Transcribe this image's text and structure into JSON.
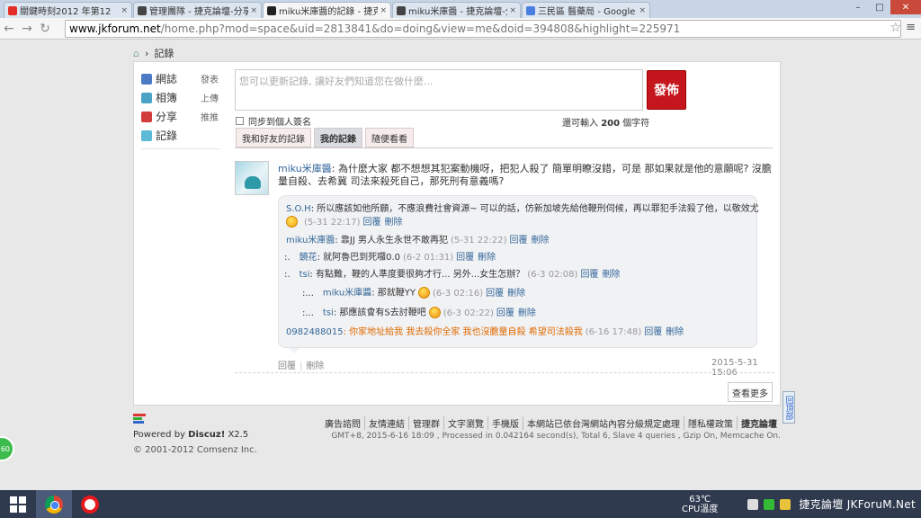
{
  "browser": {
    "tabs": [
      {
        "title": "關鍵時刻2012 年第12",
        "favicon_color": "#e52d27",
        "icon": "youtube-icon",
        "active": false
      },
      {
        "title": "管理團隊 - 捷克論壇-分享",
        "favicon_color": "#444444",
        "icon": "site-icon",
        "active": false
      },
      {
        "title": "miku米庫醬的記錄 - 捷克",
        "favicon_color": "#222222",
        "icon": "site-icon",
        "active": true
      },
      {
        "title": "miku米庫醬 - 捷克論壇-分享",
        "favicon_color": "#444444",
        "icon": "site-icon",
        "active": false
      },
      {
        "title": "三民區 醫藥局 - Google 搜",
        "favicon_color": "#4a7ee0",
        "icon": "google-icon",
        "active": false
      }
    ],
    "url_host": "www.jkforum.net",
    "url_path": "/home.php?mod=space&uid=2813841&do=doing&view=me&doid=394808&highlight=225971",
    "win_min": "–",
    "win_max": "□",
    "win_close": "✕",
    "tab_close": "×",
    "back": "←",
    "forward": "→",
    "reload": "↻",
    "star": "☆",
    "menu": "≡"
  },
  "breadcrumb": {
    "home_icon": "⌂",
    "sep": "›",
    "current": "記錄"
  },
  "sidebar": {
    "items": [
      {
        "label": "網誌",
        "action": "發表",
        "color": "#4a7bc4",
        "icon": "blog-icon"
      },
      {
        "label": "相簿",
        "action": "上傳",
        "color": "#4aa3c4",
        "icon": "album-icon"
      },
      {
        "label": "分享",
        "action": "推推",
        "color": "#d33b3b",
        "icon": "share-icon"
      },
      {
        "label": "記錄",
        "action": "",
        "color": "#5bbad5",
        "icon": "record-icon"
      }
    ]
  },
  "composer": {
    "placeholder": "您可以更新記錄, 讓好友們知道您在做什麼...",
    "post_button": "發佈",
    "sync_label": "同步到個人簽名",
    "remain_prefix": "還可輸入",
    "remain_count": "200",
    "remain_suffix": "個字符"
  },
  "subtabs": [
    {
      "label": "我和好友的記錄",
      "active": false
    },
    {
      "label": "我的記錄",
      "active": true
    },
    {
      "label": "隨便看看",
      "active": false
    }
  ],
  "feed": {
    "author": "miku米庫醬",
    "message": ": 為什麼大家 都不想想其犯案動機呀，把犯人殺了 簡單明瞭沒錯，可是 那如果就是他的意願呢? 沒膽量自殺、去希冀 司法來殺死自己，那死刑有意義嗎?",
    "reply_label": "回覆",
    "delete_label": "刪除",
    "date": "2015-5-31 15:06",
    "comments": [
      {
        "indent": "",
        "user": "S.O.H",
        "text": ": 所以應該如他所願，不應浪費社會資源~   可以的話，仿新加坡先給他鞭刑伺候，再以罪犯手法殺了他，以敬效尤",
        "time": "(5-31 22:17)",
        "emoji": true,
        "emoji_line2": true
      },
      {
        "indent": "",
        "user": "miku米庫醬",
        "text": ": 靠JJ  男人永生永世不敢再犯",
        "time": "(5-31 22:22)",
        "emoji": false
      },
      {
        "indent": ":.",
        "user": "鏡花",
        "text": ": 就阿魯巴到死囉0.0",
        "time": "(6-2 01:31)",
        "emoji": false
      },
      {
        "indent": ":.",
        "user": "tsi",
        "text": ": 有點難，鞭的人準度要很夠才行... 另外...女生怎辦？",
        "time": "(6-3 02:08)",
        "emoji": false
      },
      {
        "indent": ":...",
        "user": "miku米庫醬",
        "text": ": 那就鞭YY",
        "time": "(6-3 02:16)",
        "emoji": true
      },
      {
        "indent": ":...",
        "user": "tsi",
        "text": ": 那應該會有S去討鞭吧",
        "time": "(6-3 02:22)",
        "emoji": true
      },
      {
        "indent": "",
        "user": "0982488015",
        "text": ": 你家地址給我   我去殺你全家   我也沒膽量自殺   希望司法殺我",
        "time": "(6-16 17:48)",
        "emoji": false,
        "orange": true
      }
    ]
  },
  "more_button": "查看更多",
  "back_to_top": "回頂部",
  "footer": {
    "powered_prefix": "Powered by",
    "powered_name": "Discuz!",
    "powered_version": "X2.5",
    "copyright": "© 2001-2012 Comsenz Inc.",
    "links": [
      "廣告諮問",
      "友情連結",
      "管理群",
      "文字瀏覽",
      "手機版",
      "本網站已依台灣網站內容分級規定處理",
      "隱私權政策",
      "捷克論壇"
    ],
    "info": "GMT+8, 2015-6-16 18:09 , Processed in 0.042164 second(s), Total 6, Slave 4 queries , Gzip On, Memcache On."
  },
  "badge": "60",
  "taskbar": {
    "temp": "63℃",
    "cpu": "CPU溫度",
    "brand": "捷克論壇 JKForuM.Net"
  }
}
